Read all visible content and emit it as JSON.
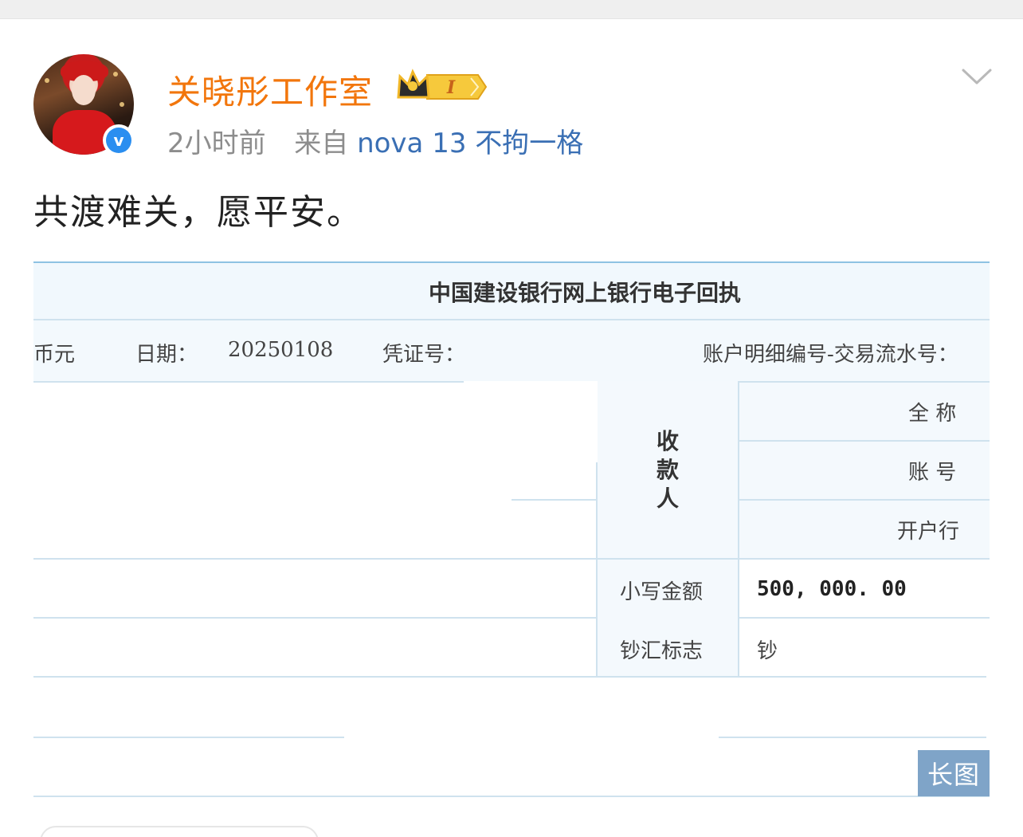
{
  "post": {
    "username": "关晓彤工作室",
    "vip_badge_text": "I",
    "time": "2小时前",
    "from_label": "来自",
    "device": "nova 13 不拘一格",
    "text": "共渡难关，愿平安。",
    "verified_icon": "verified-v-icon",
    "verified_symbol": "v",
    "more_icon": "chevron-down-icon"
  },
  "receipt": {
    "title": "中国建设银行网上银行电子回执",
    "currency_fragment": "币元",
    "date_label": "日期：",
    "date_value": "20250108",
    "voucher_label": "凭证号：",
    "serial_label": "账户明细编号-交易流水号：",
    "payee_label": "收\n款\n人",
    "full_name_label": "全  称",
    "account_label": "账  号",
    "bank_label": "开户行",
    "amount_label": "小写金额",
    "amount_value": "500, 000. 00",
    "cash_flag_label": "钞汇标志",
    "cash_flag_value": "钞"
  },
  "long_image_badge": "长图",
  "colors": {
    "username": "#f2760c",
    "device_link": "#3a6fb4",
    "meta": "#8d8d8d",
    "verified": "#2a8ef0",
    "long_image_badge": "#7fa4c8",
    "receipt_lines": "#cfe2ee"
  }
}
